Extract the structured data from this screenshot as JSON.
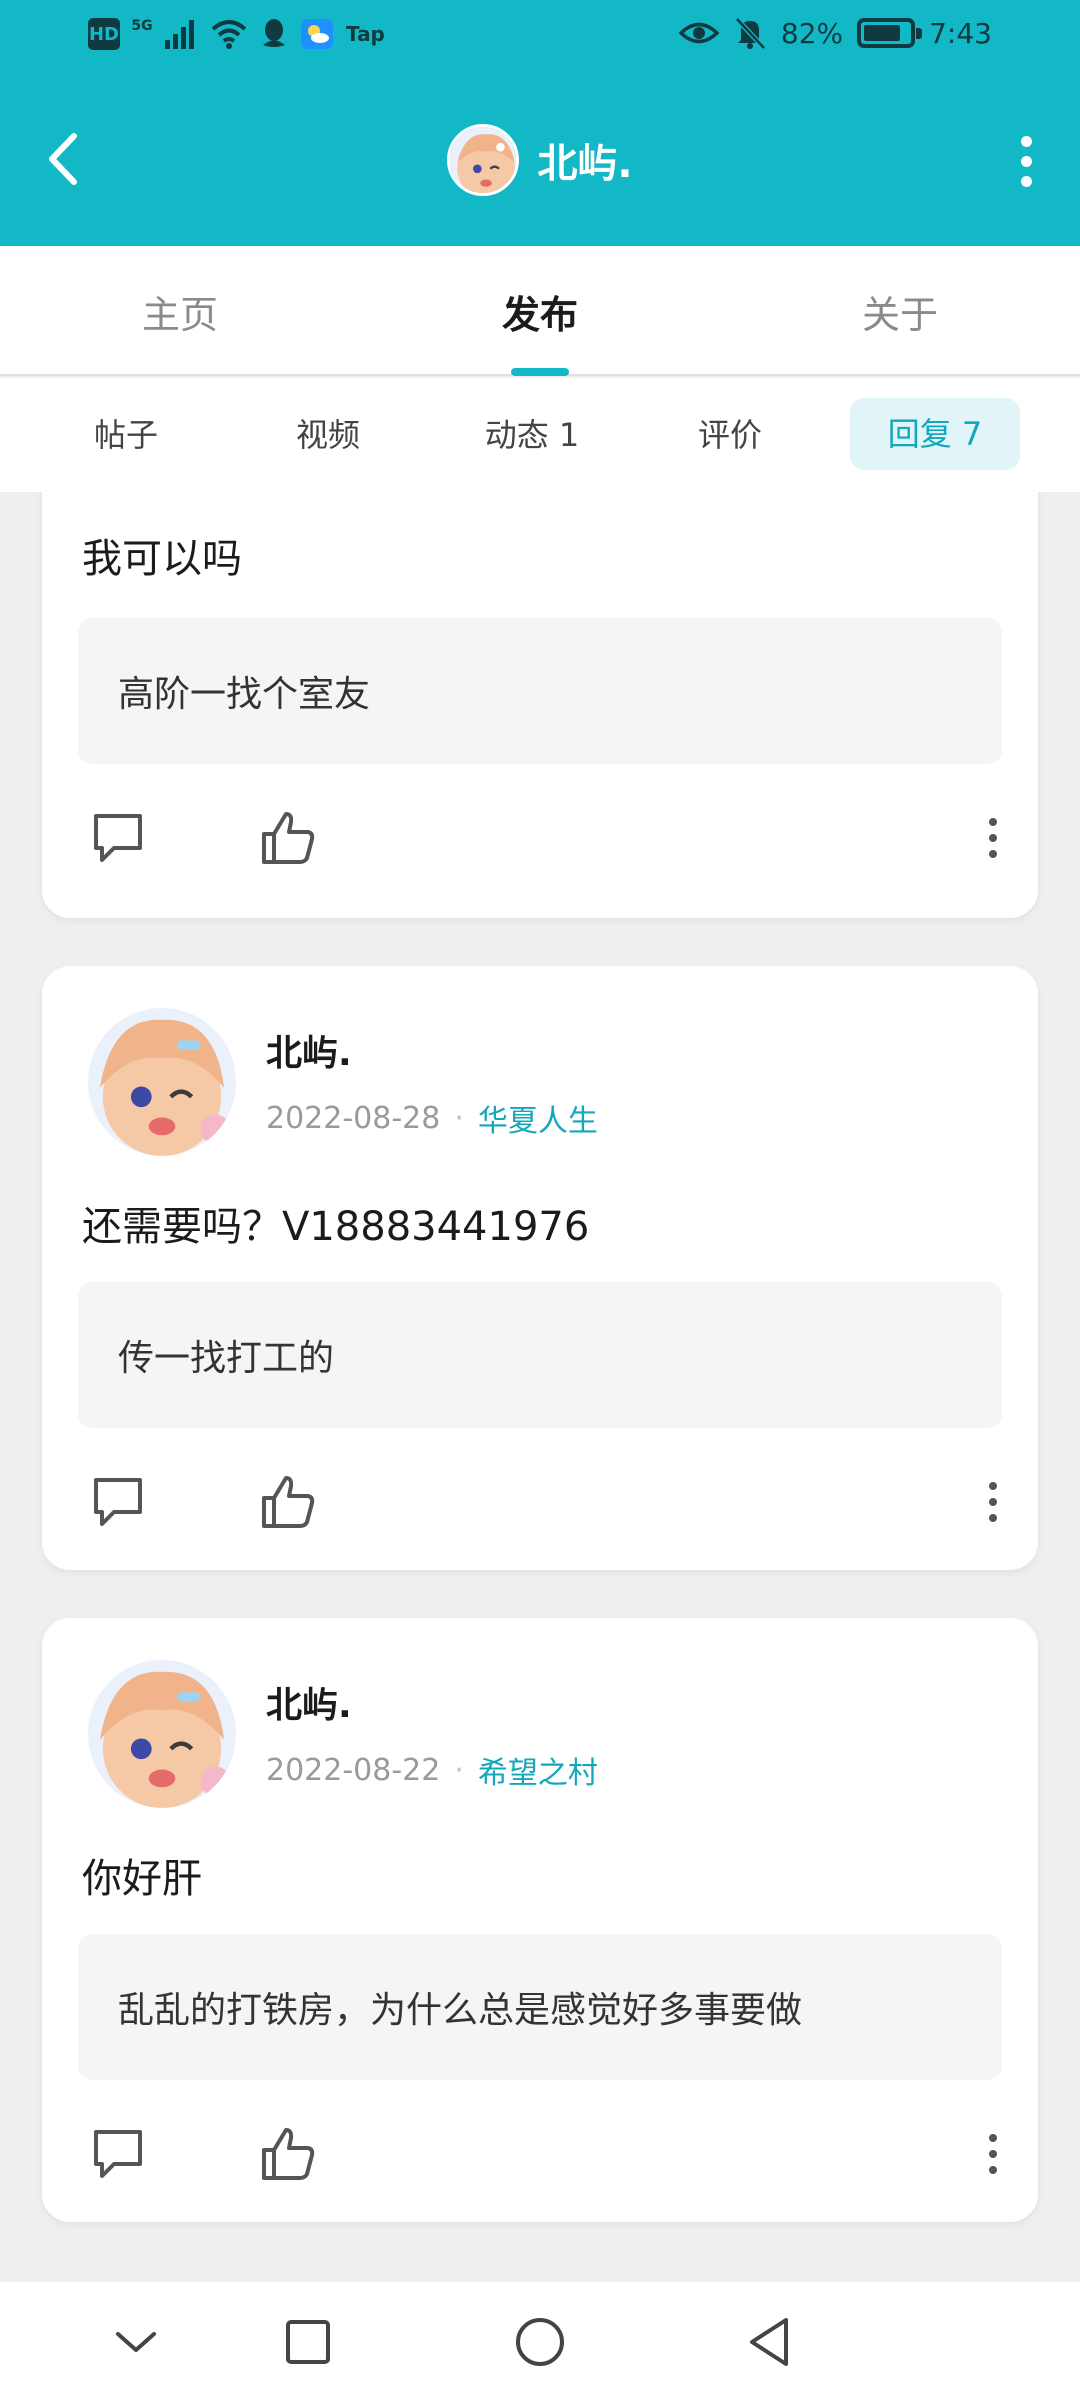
{
  "status_bar": {
    "hd": "HD",
    "network": "5G",
    "tap": "Tap",
    "battery_percent": "82%",
    "battery_level": 0.82,
    "time": "7:43",
    "icons": [
      "signal-icon",
      "wifi-icon",
      "qq-icon",
      "weather-icon",
      "eye-icon",
      "mute-bell-icon",
      "battery-icon"
    ]
  },
  "header": {
    "title": "北屿."
  },
  "main_tabs": [
    "主页",
    "发布",
    "关于"
  ],
  "sub_tabs": [
    "帖子",
    "视频",
    "动态 1",
    "评价",
    "回复 7"
  ],
  "posts": [
    {
      "reply": "我可以吗",
      "quote": "高阶一找个室友"
    },
    {
      "author": "北屿.",
      "date": "2022-08-28",
      "topic": "华夏人生",
      "reply": "还需要吗？V18883441976",
      "quote": "传一找打工的"
    },
    {
      "author": "北屿.",
      "date": "2022-08-22",
      "topic": "希望之村",
      "reply": "你好肝",
      "quote": "乱乱的打铁房，为什么总是感觉好多事要做"
    }
  ],
  "colors": {
    "accent": "#13b8c7",
    "topic": "#13a7bb",
    "active_subtab_bg": "#e1f4f8"
  }
}
